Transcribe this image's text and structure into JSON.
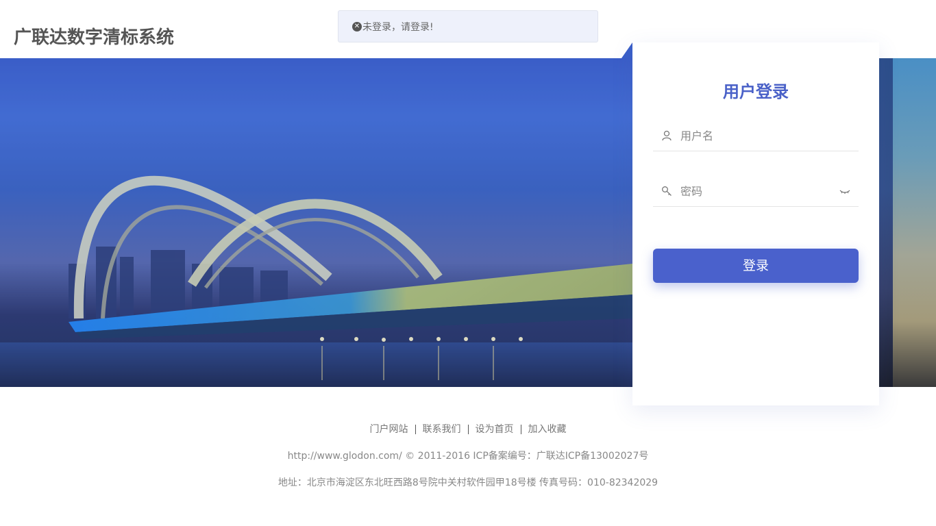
{
  "header": {
    "title": "广联达数字清标系统"
  },
  "toast": {
    "icon": "error-circle-icon",
    "message": "未登录，请登录!"
  },
  "login": {
    "title": "用户登录",
    "username_placeholder": "用户名",
    "password_placeholder": "密码",
    "submit_label": "登录",
    "accent_color": "#4a61cc"
  },
  "footer": {
    "links": [
      "门户网站",
      "联系我们",
      "设为首页",
      "加入收藏"
    ],
    "copyright": "http://www.glodon.com/ © 2011-2016 ICP备案编号：广联达ICP备13002027号",
    "address": "地址：北京市海淀区东北旺西路8号院中关村软件园甲18号楼 传真号码：010-82342029"
  }
}
